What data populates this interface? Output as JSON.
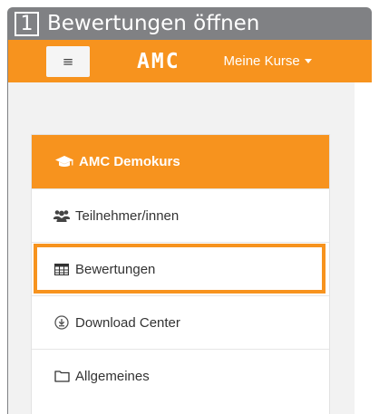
{
  "step": {
    "number": "1",
    "title": "Bewertungen öffnen"
  },
  "navbar": {
    "menu_icon": "hamburger-icon",
    "brand": "AMC",
    "my_courses": "Meine Kurse"
  },
  "course_block": {
    "title": "AMC Demokurs",
    "icon": "graduation-cap-icon",
    "items": [
      {
        "label": "Teilnehmer/innen",
        "icon": "users-icon"
      },
      {
        "label": "Bewertungen",
        "icon": "table-icon",
        "highlighted": true
      },
      {
        "label": "Download Center",
        "icon": "download-circle-icon"
      },
      {
        "label": "Allgemeines",
        "icon": "folder-icon"
      }
    ]
  },
  "colors": {
    "accent": "#f7931e",
    "frame": "#808184",
    "drawer_bg": "#f2f2f2"
  }
}
